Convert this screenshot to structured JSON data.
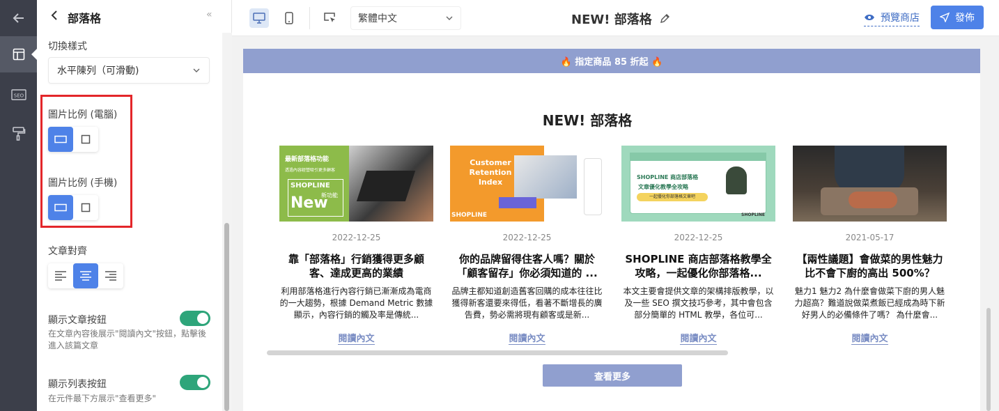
{
  "panel": {
    "title": "部落格",
    "collapse_glyph": "«",
    "switch_style_label": "切換樣式",
    "switch_style_value": "水平陳列（可滑動)",
    "ratio_desktop_label": "圖片比例 (電腦)",
    "ratio_mobile_label": "圖片比例 (手機)",
    "align_label": "文章對齊",
    "show_article_btn_label": "顯示文章按鈕",
    "show_article_btn_hint": "在文章內容後展示\"閱讀內文\"按鈕，點擊後進入該篇文章",
    "show_list_btn_label": "顯示列表按鈕",
    "show_list_btn_hint": "在元件最下方展示\"查看更多\""
  },
  "toolbar": {
    "language": "繁體中文",
    "page_title": "NEW! 部落格",
    "preview_label": "預覽商店",
    "publish_label": "發佈"
  },
  "canvas": {
    "banner": "🔥 指定商品 85 折起 🔥",
    "section_title": "NEW! 部落格",
    "more_button": "查看更多",
    "cards": [
      {
        "date": "2022-12-25",
        "title": "靠「部落格」行銷獲得更多顧客、達成更高的業績",
        "excerpt": "利用部落格進行內容行銷已漸漸成為電商的一大趨勢，根據 Demand Metric 數據顯示，內容行銷的觸及率是傳統...",
        "read": "閱讀內文",
        "img_text_1": "最新部落格功能",
        "img_text_2": "透過內容經營吸引更多顧客",
        "img_text_3": "SHOPLINE",
        "img_text_4": "新功能",
        "img_text_5": "New"
      },
      {
        "date": "2022-12-25",
        "title": "你的品牌留得住客人嗎？關於「顧客留存」你必須知道的 ...",
        "excerpt": "品牌主都知道創造舊客回購的成本往往比獲得新客還要來得低，看著不斷增長的廣告費，勢必需將現有顧客或是新...",
        "read": "閱讀內文",
        "img_text_1": "Customer Retention Index",
        "img_text_2": "SHOPLINE"
      },
      {
        "date": "2022-12-25",
        "title": "SHOPLINE 商店部落格教學全攻略，一起優化你部落格...",
        "excerpt": "本文主要會提供文章的架構排版教學，以及一些 SEO 撰文技巧參考，其中會包含部分簡單的 HTML 教學，各位可...",
        "read": "閱讀內文",
        "img_text_1": "SHOPLINE 商店部落格",
        "img_text_2": "文章優化教學全攻略",
        "img_text_3": "一起優化你部落格文章吧",
        "img_text_4": "SHOPLINE"
      },
      {
        "date": "2021-05-17",
        "title": "【兩性議題】會做菜的男性魅力比不會下廚的高出 500%？",
        "excerpt": "魅力1 魅力2 為什麼會做菜下廚的男人魅力超高？難道說做菜煮飯已經成為時下新好男人的必備條件了嗎？ 為什麼會...",
        "read": "閱讀內文"
      }
    ]
  },
  "colors": {
    "accent": "#4e82e8",
    "banner": "#909fcf",
    "toggle_on": "#2ea57a",
    "highlight": "#e3262a"
  }
}
